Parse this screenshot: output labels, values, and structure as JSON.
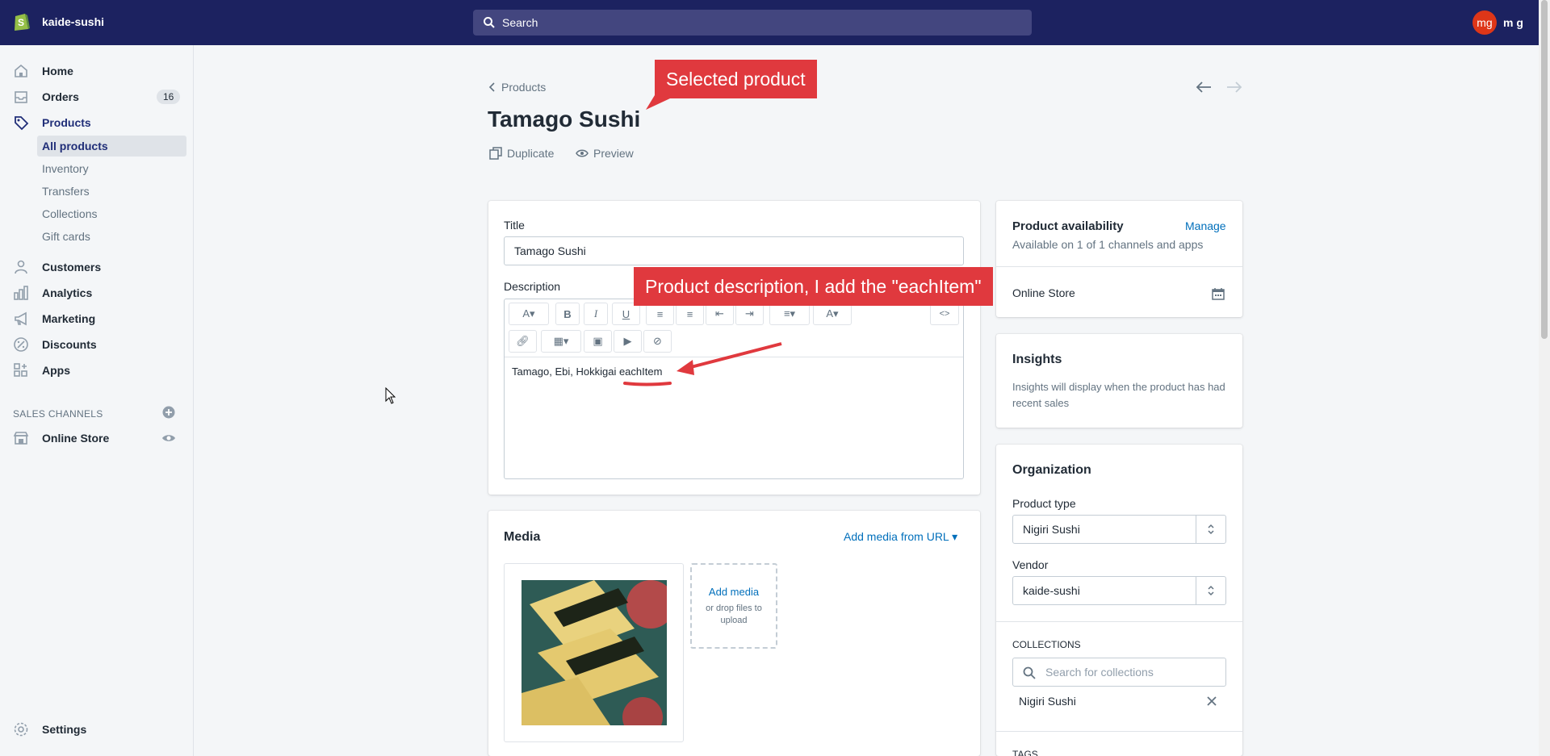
{
  "topbar": {
    "store_name": "kaide-sushi",
    "search_placeholder": "Search",
    "avatar_initials": "mg",
    "user_name": "m g"
  },
  "sidebar": {
    "items": [
      {
        "label": "Home",
        "icon": "home-icon"
      },
      {
        "label": "Orders",
        "icon": "orders-icon",
        "badge": "16"
      },
      {
        "label": "Products",
        "icon": "tag-icon"
      },
      {
        "label": "Customers",
        "icon": "person-icon"
      },
      {
        "label": "Analytics",
        "icon": "bar-chart-icon"
      },
      {
        "label": "Marketing",
        "icon": "megaphone-icon"
      },
      {
        "label": "Discounts",
        "icon": "discount-icon"
      },
      {
        "label": "Apps",
        "icon": "apps-icon"
      }
    ],
    "product_subitems": [
      "All products",
      "Inventory",
      "Transfers",
      "Collections",
      "Gift cards"
    ],
    "channels_title": "SALES CHANNELS",
    "online_store": "Online Store",
    "settings": "Settings"
  },
  "page": {
    "breadcrumb": "Products",
    "title": "Tamago Sushi",
    "duplicate": "Duplicate",
    "preview": "Preview"
  },
  "product_form": {
    "title_label": "Title",
    "title_value": "Tamago Sushi",
    "description_label": "Description",
    "description_text_plain": "Tamago, Ebi, Hokkigai ",
    "description_text_highlight": "eachItem"
  },
  "media": {
    "title": "Media",
    "add_from_url": "Add media from URL",
    "add_media": "Add media",
    "drop_hint": "or drop files to upload"
  },
  "availability": {
    "title": "Product availability",
    "manage": "Manage",
    "summary": "Available on 1 of 1 channels and apps",
    "channel": "Online Store"
  },
  "insights": {
    "title": "Insights",
    "text": "Insights will display when the product has had recent sales"
  },
  "organization": {
    "title": "Organization",
    "product_type_label": "Product type",
    "product_type_value": "Nigiri Sushi",
    "vendor_label": "Vendor",
    "vendor_value": "kaide-sushi",
    "collections_label": "COLLECTIONS",
    "collections_placeholder": "Search for collections",
    "collection_tag": "Nigiri Sushi",
    "tags_label": "TAGS"
  },
  "annotations": {
    "callout_1": "Selected product",
    "callout_2": "Product description, I add the \"eachItem\""
  },
  "colors": {
    "topbar": "#1c2260",
    "accent_link": "#006fbb",
    "annotation_red": "#e0393e"
  }
}
